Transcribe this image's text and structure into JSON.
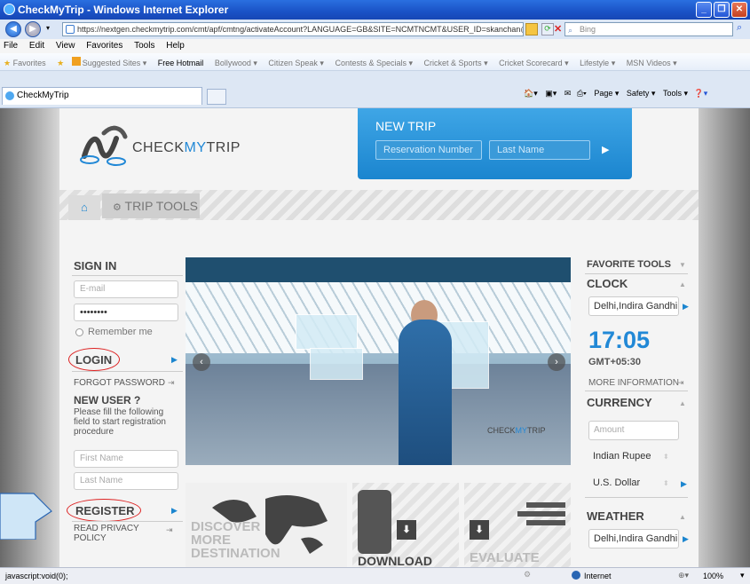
{
  "window": {
    "title": "CheckMyTrip - Windows Internet Explorer"
  },
  "browser": {
    "url": "https://nextgen.checkmytrip.com/cmt/apf/cmtng/activateAccount?LANGUAGE=GB&SITE=NCMTNCMT&USER_ID=skanchan@amade",
    "search_placeholder": "Bing",
    "menu": [
      "File",
      "Edit",
      "View",
      "Favorites",
      "Tools",
      "Help"
    ],
    "favorites_label": "Favorites",
    "favorites": [
      "Suggested Sites ▾",
      "Free Hotmail",
      "Bollywood ▾",
      "Citizen Speak ▾",
      "Contests & Specials ▾",
      "Cricket & Sports ▾",
      "Cricket Scorecard ▾",
      "Lifestyle ▾",
      "MSN Videos ▾"
    ],
    "tab_title": "CheckMyTrip",
    "commands": [
      "Page ▾",
      "Safety ▾",
      "Tools ▾"
    ],
    "status_text": "javascript:void(0);",
    "zone": "Internet",
    "zoom": "100%"
  },
  "site": {
    "logo_text_a": "CHECK",
    "logo_text_b": "MY",
    "logo_text_c": "TRIP",
    "new_trip": {
      "title": "NEW TRIP",
      "reservation_placeholder": "Reservation Number",
      "lastname_placeholder": "Last Name"
    },
    "trip_tools": "TRIP TOOLS",
    "sign_in": {
      "title": "SIGN IN",
      "email_placeholder": "E-mail",
      "password_value": "••••••••",
      "remember_me": "Remember me",
      "login": "LOGIN",
      "forgot_password": "FORGOT PASSWORD",
      "new_user_title": "NEW USER ?",
      "new_user_text": "Please fill the following field to start registration procedure",
      "first_name_placeholder": "First Name",
      "last_name_placeholder": "Last Name",
      "register": "REGISTER",
      "privacy": "READ PRIVACY POLICY"
    },
    "hero_logo_a": "CHECK",
    "hero_logo_b": "MY",
    "hero_logo_c": "TRIP",
    "tiles": {
      "discover": "DISCOVER MORE DESTINATION",
      "download": "DOWNLOAD",
      "evaluate": "EVALUATE"
    },
    "right": {
      "favorite_tools": "FAVORITE TOOLS",
      "clock": "CLOCK",
      "clock_city": "Delhi,Indira Gandhi",
      "time": "17:05",
      "gmt": "GMT+05:30",
      "more_info": "MORE INFORMATION",
      "currency": "CURRENCY",
      "amount_placeholder": "Amount",
      "currency_from": "Indian Rupee",
      "currency_to": "U.S. Dollar",
      "weather": "WEATHER",
      "weather_city": "Delhi,Indira Gandhi"
    }
  }
}
